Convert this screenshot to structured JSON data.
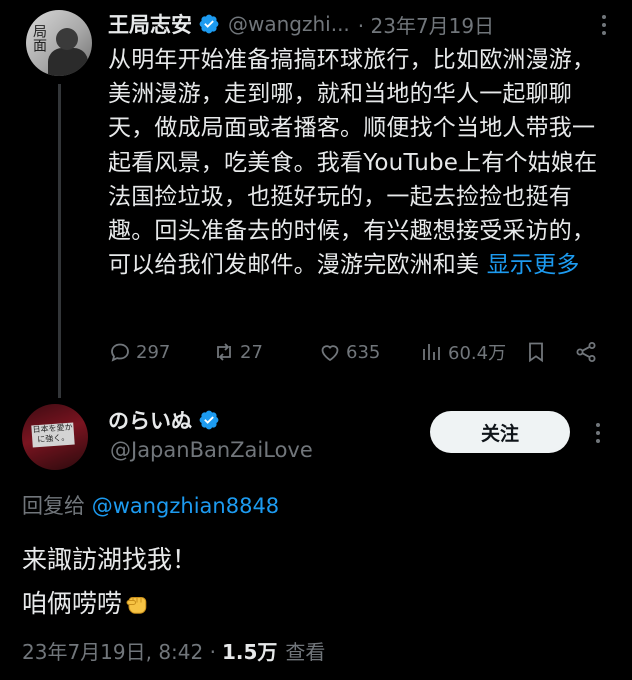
{
  "tweet1": {
    "name": "王局志安",
    "handle": "@wangzhi...",
    "date": "· 23年7月19日",
    "text": "从明年开始准备搞搞环球旅行，比如欧洲漫游，美洲漫游，走到哪，就和当地的华人一起聊聊天，做成局面或者播客。顺便找个当地人带我一起看风景，吃美食。我看YouTube上有个姑娘在法国捡垃圾，也挺好玩的，一起去捡捡也挺有趣。回头准备去的时候，有兴趣想接受采访的，可以给我们发邮件。漫游完欧洲和美 ",
    "show_more": "显示更多",
    "replies": "297",
    "retweets": "27",
    "likes": "635",
    "views": "60.4万"
  },
  "tweet2": {
    "name": "のらいぬ",
    "handle": "@JapanBanZaiLove",
    "follow_label": "关注",
    "reply_prefix": "回复给 ",
    "reply_mention": "@wangzhian8848",
    "line1": "来諏訪湖找我！",
    "line2": "咱俩唠唠",
    "timestamp": "23年7月19日, 8:42 ·",
    "views": "1.5万",
    "views_label": "查看",
    "avatar_text": "日本を愛かに強く。"
  },
  "colors": {
    "background": "#000000",
    "text": "#e7e9ea",
    "muted": "#71767b",
    "accent": "#1d9bf0",
    "follow_bg": "#eff3f4"
  },
  "icons": [
    "verified-badge-icon",
    "more-options-icon",
    "reply-icon",
    "retweet-icon",
    "like-icon",
    "views-icon",
    "bookmark-icon",
    "share-icon",
    "fist-emoji-icon"
  ]
}
